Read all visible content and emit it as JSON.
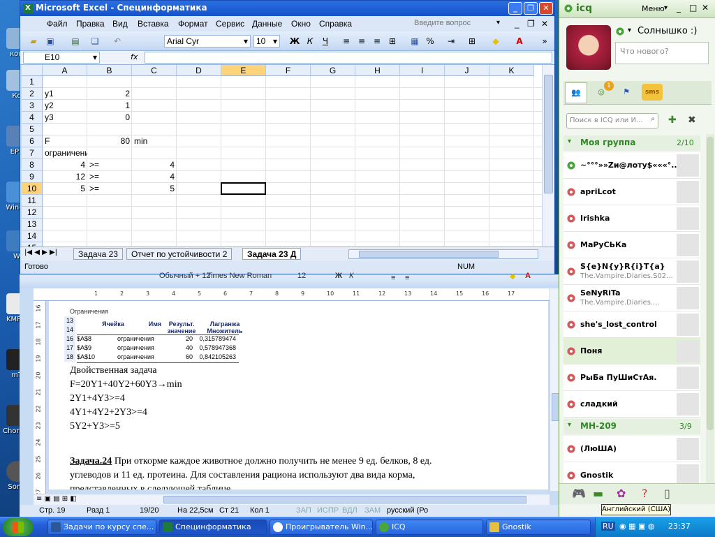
{
  "desktop": {
    "icons": [
      "ком",
      "Ко",
      "EPS",
      "Windo",
      "W",
      "KMPla",
      "mT",
      "m",
      "ChordPu",
      "Song"
    ]
  },
  "excel": {
    "title": "Microsoft Excel - Специнформатика",
    "menu": [
      "Файл",
      "Правка",
      "Вид",
      "Вставка",
      "Формат",
      "Сервис",
      "Данные",
      "Окно",
      "Справка"
    ],
    "help_placeholder": "Введите вопрос",
    "font": "Arial Cyr",
    "size": "10",
    "cell_ref": "E10",
    "fx": "fx",
    "columns": [
      "A",
      "B",
      "C",
      "D",
      "E",
      "F",
      "G",
      "H",
      "I",
      "J",
      "K"
    ],
    "rows": [
      "1",
      "2",
      "3",
      "4",
      "5",
      "6",
      "7",
      "8",
      "9",
      "10",
      "11",
      "12",
      "13",
      "14",
      "15"
    ],
    "cells": [
      {
        "r": 2,
        "c": "A",
        "v": "y1"
      },
      {
        "r": 2,
        "c": "B",
        "v": "2",
        "align": "right"
      },
      {
        "r": 3,
        "c": "A",
        "v": "y2"
      },
      {
        "r": 3,
        "c": "B",
        "v": "1",
        "align": "right"
      },
      {
        "r": 4,
        "c": "A",
        "v": "y3"
      },
      {
        "r": 4,
        "c": "B",
        "v": "0",
        "align": "right"
      },
      {
        "r": 6,
        "c": "A",
        "v": "F"
      },
      {
        "r": 6,
        "c": "B",
        "v": "80",
        "align": "right"
      },
      {
        "r": 6,
        "c": "C",
        "v": "min"
      },
      {
        "r": 7,
        "c": "A",
        "v": "ограничения"
      },
      {
        "r": 8,
        "c": "A",
        "v": "4",
        "align": "right"
      },
      {
        "r": 8,
        "c": "B",
        "v": ">="
      },
      {
        "r": 8,
        "c": "C",
        "v": "4",
        "align": "right"
      },
      {
        "r": 9,
        "c": "A",
        "v": "12",
        "align": "right"
      },
      {
        "r": 9,
        "c": "B",
        "v": ">="
      },
      {
        "r": 9,
        "c": "C",
        "v": "4",
        "align": "right"
      },
      {
        "r": 10,
        "c": "A",
        "v": "5",
        "align": "right"
      },
      {
        "r": 10,
        "c": "B",
        "v": ">="
      },
      {
        "r": 10,
        "c": "C",
        "v": "5",
        "align": "right"
      }
    ],
    "sheets": [
      "Задача 23",
      "Отчет по устойчивости 2",
      "Задача 23 Д"
    ],
    "status_left": "Готово",
    "status_right": "NUM"
  },
  "word": {
    "font": "Обычный + 12 г",
    "font2": "Times New Roman",
    "size": "12",
    "table_title": "Ограничения",
    "table_headers": [
      "Ячейка",
      "Имя",
      "Результ. значение",
      "Лагранжа Множитель"
    ],
    "table_rows": [
      {
        "n": "13",
        "c": [
          "",
          "",
          "",
          ""
        ]
      },
      {
        "n": "14",
        "c": [
          "Ячейка",
          "Имя",
          "значение",
          "Множитель"
        ]
      },
      {
        "n": "16",
        "c": [
          "$A$8",
          "ограничения",
          "20",
          "0,315789474"
        ]
      },
      {
        "n": "17",
        "c": [
          "$A$9",
          "ограничения",
          "40",
          "0,578947368"
        ]
      },
      {
        "n": "18",
        "c": [
          "$A$10",
          "ограничения",
          "60",
          "0,842105263"
        ]
      }
    ],
    "lines": [
      "Двойственная задача",
      "F=20Y1+40Y2+60Y3→min",
      "2Y1+4Y3>=4",
      "4Y1+4Y2+2Y3>=4",
      "5Y2+Y3>=5"
    ],
    "task_bold": "Задача.24",
    "task_text": " При откорме каждое животное должно получить не менее 9 ед. белков, 8 ед.",
    "task_text2": "углеводов и 11 ед. протеина. Для составления рациона используют два вида корма,",
    "task_text3": "представленных в следующей таблице.",
    "status": [
      "Стр. 19",
      "Разд 1",
      "19/20",
      "На 22,5см",
      "Ст 21",
      "Кол 1",
      "ЗАП",
      "ИСПР",
      "ВДЛ",
      "ЗАМ",
      "русский (Ро"
    ]
  },
  "icq": {
    "title": "icq",
    "menu": "Меню",
    "nick": "Солнышко :)",
    "mood_placeholder": "Что нового?",
    "search_placeholder": "Поиск в ICQ или И...",
    "badge": "1",
    "groups": [
      {
        "name": "Моя группа",
        "count": "2/10"
      },
      {
        "name": "МН-209",
        "count": "3/9"
      }
    ],
    "contacts1": [
      {
        "name": "~°°°»»Zи@лоту$«««°...",
        "status": "",
        "on": true
      },
      {
        "name": "apriLcot",
        "status": "",
        "on": false
      },
      {
        "name": "Irishka",
        "status": "",
        "on": false
      },
      {
        "name": "МаРуСЬКа",
        "status": "",
        "on": false
      },
      {
        "name": "S{e}N{y}R{i}T{a}",
        "status": "The.Vampire.Diaries.S02...",
        "on": false
      },
      {
        "name": "SeNyRiTa",
        "status": "The.Vampire.Diaries....",
        "on": false
      },
      {
        "name": "she's_lost_control",
        "status": "",
        "on": false
      },
      {
        "name": "Поня",
        "status": "",
        "on": false
      },
      {
        "name": "РыБа ПуШиСтАя.",
        "status": "",
        "on": false
      },
      {
        "name": "сладкий",
        "status": "",
        "on": false
      }
    ],
    "contacts2": [
      {
        "name": "(ЛюША)",
        "status": "",
        "on": false
      },
      {
        "name": "Gnostik",
        "status": "",
        "on": false
      }
    ],
    "tooltip": "Английский (США)"
  },
  "taskbar": {
    "tasks": [
      "Задачи по курсу спе...",
      "Специнформатика",
      "Проигрыватель Win...",
      "ICQ",
      "Gnostik"
    ],
    "lang": "RU",
    "time": "23:37"
  }
}
